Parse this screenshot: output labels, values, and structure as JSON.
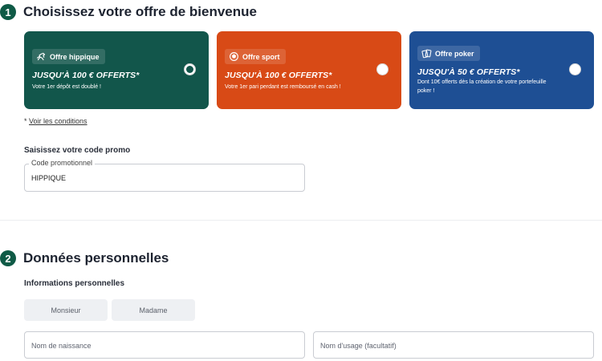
{
  "step1": {
    "number": "1",
    "title": "Choisissez votre offre de bienvenue"
  },
  "offers": [
    {
      "tag": "Offre hippique",
      "icon": "horse-icon",
      "headline": "JUSQU'À 100 € OFFERTS*",
      "sub": "Votre 1er dépôt est doublé !",
      "color": "#12564b",
      "selected": true
    },
    {
      "tag": "Offre sport",
      "icon": "football-icon",
      "headline": "JUSQU'À 100 € OFFERTS*",
      "sub": "Votre 1er pari perdant est remboursé en cash !",
      "color": "#d84a16",
      "selected": false
    },
    {
      "tag": "Offre poker",
      "icon": "poker-cards-icon",
      "headline": "JUSQU'À 50 € OFFERTS*",
      "sub": "Dont 10€ offerts dès la création de votre portefeuille poker !",
      "color": "#1e4f94",
      "selected": false
    }
  ],
  "conditions": {
    "prefix": "* ",
    "link": "Voir les conditions"
  },
  "promo": {
    "title": "Saisissez votre code promo",
    "legend": "Code promotionnel",
    "value": "HIPPIQUE"
  },
  "step2": {
    "number": "2",
    "title": "Données personnelles"
  },
  "personal": {
    "title": "Informations personnelles",
    "civility": [
      "Monsieur",
      "Madame"
    ],
    "birth_name_placeholder": "Nom de naissance",
    "usage_name_placeholder": "Nom d'usage (facultatif)"
  }
}
